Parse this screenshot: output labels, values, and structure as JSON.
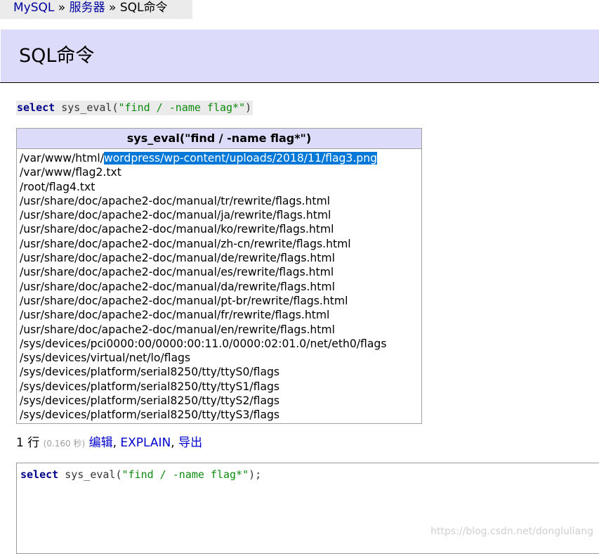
{
  "breadcrumb": {
    "items": [
      "MySQL",
      "服务器",
      "SQL命令"
    ],
    "separator": "»"
  },
  "header": {
    "title": "SQL命令"
  },
  "query": {
    "keyword": "select",
    "function": "sys_eval(",
    "string": "\"find / -name flag*\"",
    "close": ")"
  },
  "result": {
    "column_header": "sys_eval(\"find / -name flag*\")",
    "first_prefix": "/var/www/html/",
    "first_selected": "wordpress/wp-content/uploads/2018/11/flag3.png",
    "rows": [
      "/var/www/flag2.txt",
      "/root/flag4.txt",
      "/usr/share/doc/apache2-doc/manual/tr/rewrite/flags.html",
      "/usr/share/doc/apache2-doc/manual/ja/rewrite/flags.html",
      "/usr/share/doc/apache2-doc/manual/ko/rewrite/flags.html",
      "/usr/share/doc/apache2-doc/manual/zh-cn/rewrite/flags.html",
      "/usr/share/doc/apache2-doc/manual/de/rewrite/flags.html",
      "/usr/share/doc/apache2-doc/manual/es/rewrite/flags.html",
      "/usr/share/doc/apache2-doc/manual/da/rewrite/flags.html",
      "/usr/share/doc/apache2-doc/manual/pt-br/rewrite/flags.html",
      "/usr/share/doc/apache2-doc/manual/fr/rewrite/flags.html",
      "/usr/share/doc/apache2-doc/manual/en/rewrite/flags.html",
      "/sys/devices/pci0000:00/0000:00:11.0/0000:02:01.0/net/eth0/flags",
      "/sys/devices/virtual/net/lo/flags",
      "/sys/devices/platform/serial8250/tty/ttyS0/flags",
      "/sys/devices/platform/serial8250/tty/ttyS1/flags",
      "/sys/devices/platform/serial8250/tty/ttyS2/flags",
      "/sys/devices/platform/serial8250/tty/ttyS3/flags"
    ]
  },
  "stats": {
    "rows_text": "1 行",
    "time_text": "(0.160 秒)",
    "edit_link": "编辑",
    "explain_link": "EXPLAIN",
    "export_link": "导出",
    "comma": ","
  },
  "editor": {
    "keyword": "select",
    "function": "sys_eval(",
    "string": "\"find / -name flag*\"",
    "close": ");"
  },
  "watermark": "https://blog.csdn.net/dongluliang",
  "colors": {
    "link": "#0000a0",
    "header_bg": "#dcdcfa",
    "selection": "#0078d7",
    "keyword": "#00008b",
    "string": "#0d8b0d"
  }
}
